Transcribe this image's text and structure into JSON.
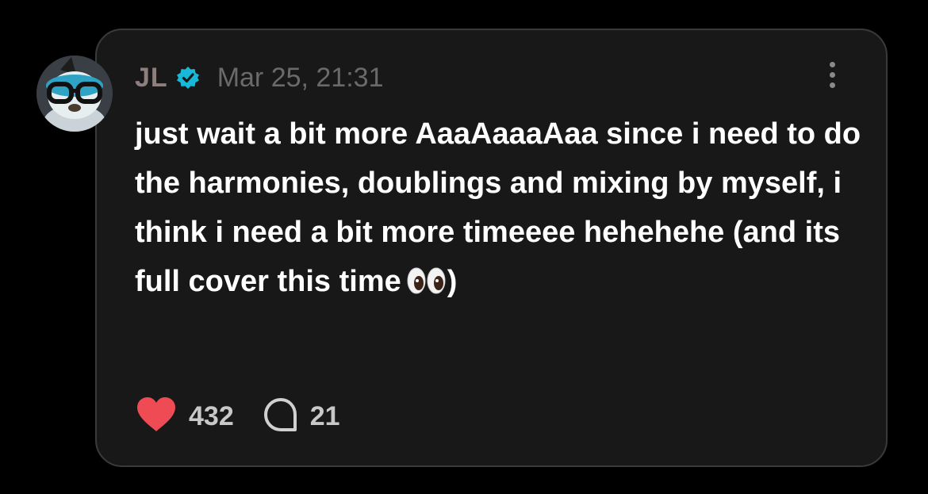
{
  "post": {
    "author": "JL",
    "verified": true,
    "timestamp": "Mar 25, 21:31",
    "text": "just wait a bit more AaaAaaaAaa since i need to do the harmonies, doublings and mixing by myself, i think i need a bit more timeeee hehehehe  (and its full cover this time",
    "text_suffix": ")",
    "emoji": "eyes-emoji",
    "likes": "432",
    "comments": "21"
  },
  "colors": {
    "background": "#000000",
    "card": "#181818",
    "card_border": "#3a3a3a",
    "username": "#8e7f7e",
    "verified": "#18b8d8",
    "timestamp": "#6a6a6a",
    "heart": "#ef4b55",
    "text": "#ffffff"
  },
  "icons": {
    "verified": "verified-badge-icon",
    "more": "more-vertical-icon",
    "like": "heart-icon",
    "comment": "comment-bubble-icon"
  }
}
